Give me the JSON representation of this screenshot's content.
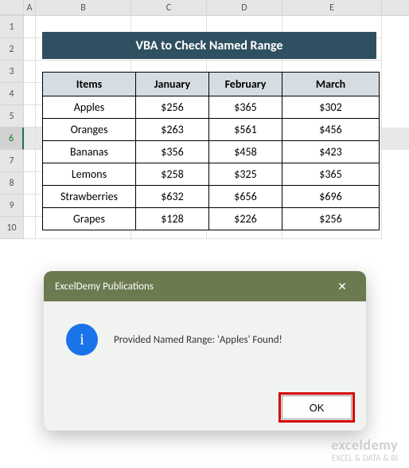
{
  "columns": [
    "A",
    "B",
    "C",
    "D",
    "E"
  ],
  "rows": [
    "1",
    "2",
    "3",
    "4",
    "5",
    "6",
    "7",
    "8",
    "9",
    "10"
  ],
  "selected_row": "6",
  "title": "VBA to Check Named Range",
  "table": {
    "headers": [
      "Items",
      "January",
      "February",
      "March"
    ],
    "rows": [
      [
        "Apples",
        "$256",
        "$365",
        "$302"
      ],
      [
        "Oranges",
        "$263",
        "$561",
        "$456"
      ],
      [
        "Bananas",
        "$356",
        "$458",
        "$423"
      ],
      [
        "Lemons",
        "$258",
        "$325",
        "$365"
      ],
      [
        "Strawberries",
        "$632",
        "$656",
        "$696"
      ],
      [
        "Grapes",
        "$128",
        "$226",
        "$256"
      ]
    ]
  },
  "dialog": {
    "title": "ExcelDemy Publications",
    "message": "Provided Named Range: 'Apples' Found!",
    "ok_label": "OK",
    "close_glyph": "✕",
    "info_glyph": "i"
  },
  "watermark": {
    "brand": "exceldemy",
    "tagline": "EXCEL & DATA & BI"
  },
  "chart_data": {
    "type": "table",
    "title": "VBA to Check Named Range",
    "categories": [
      "January",
      "February",
      "March"
    ],
    "series": [
      {
        "name": "Apples",
        "values": [
          256,
          365,
          302
        ]
      },
      {
        "name": "Oranges",
        "values": [
          263,
          561,
          456
        ]
      },
      {
        "name": "Bananas",
        "values": [
          356,
          458,
          423
        ]
      },
      {
        "name": "Lemons",
        "values": [
          258,
          325,
          365
        ]
      },
      {
        "name": "Strawberries",
        "values": [
          632,
          656,
          696
        ]
      },
      {
        "name": "Grapes",
        "values": [
          128,
          226,
          256
        ]
      }
    ]
  }
}
